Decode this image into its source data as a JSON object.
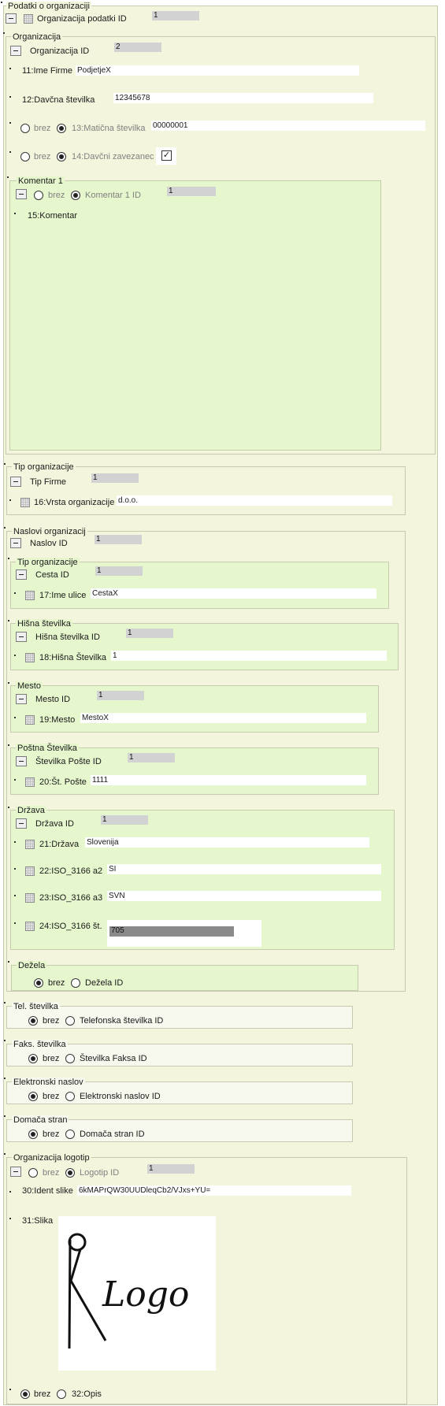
{
  "root": {
    "legend": "Podatki o organizaciji",
    "id_label": "Organizacija podatki ID",
    "id_value": "1"
  },
  "organizacija": {
    "legend": "Organizacija",
    "id_label": "Organizacija ID",
    "id_value": "2",
    "ime_label": "11:Ime Firme",
    "ime_value": "PodjetjeX",
    "davcna_label": "12:Davčna številka",
    "davcna_value": "12345678",
    "brez": "brez",
    "maticna_label": "13:Matična številka",
    "maticna_value": "00000001",
    "zavezanec_label": "14:Davčni zavezanec",
    "zavezanec_checked": true,
    "komentar": {
      "legend": "Komentar 1",
      "id_label": "Komentar 1 ID",
      "id_value": "1",
      "field_label": "15:Komentar"
    }
  },
  "tip_organizacije": {
    "legend": "Tip organizacije",
    "id_label": "Tip Firme",
    "id_value": "1",
    "vrsta_label": "16:Vrsta organizacije",
    "vrsta_value": "d.o.o."
  },
  "naslovi": {
    "legend": "Naslovi organizacij",
    "id_label": "Naslov ID",
    "id_value": "1",
    "cesta": {
      "legend": "Tip organizacije",
      "id_label": "Cesta ID",
      "id_value": "1",
      "field_label": "17:Ime ulice",
      "field_value": "CestaX"
    },
    "hisna": {
      "legend": "Hišna številka",
      "id_label": "Hišna številka ID",
      "id_value": "1",
      "field_label": "18:Hišna Številka",
      "field_value": "1"
    },
    "mesto": {
      "legend": "Mesto",
      "id_label": "Mesto ID",
      "id_value": "1",
      "field_label": "19:Mesto",
      "field_value": "MestoX"
    },
    "posta": {
      "legend": "Poštna Številka",
      "id_label": "Številka Pošte ID",
      "id_value": "1",
      "field_label": "20:Št. Pošte",
      "field_value": "1111"
    },
    "drzava": {
      "legend": "Država",
      "id_label": "Država ID",
      "id_value": "1",
      "drzava_label": "21:Država",
      "drzava_value": "Slovenija",
      "a2_label": "22:ISO_3166 a2",
      "a2_value": "SI",
      "a3_label": "23:ISO_3166 a3",
      "a3_value": "SVN",
      "st_label": "24:ISO_3166 št.",
      "st_value": "705"
    },
    "dezela": {
      "legend": "Dežela",
      "brez": "brez",
      "option": "Dežela ID"
    }
  },
  "tel": {
    "legend": "Tel. številka",
    "brez": "brez",
    "option": "Telefonska številka ID"
  },
  "faks": {
    "legend": "Faks. številka",
    "brez": "brez",
    "option": "Številka Faksa ID"
  },
  "email": {
    "legend": "Elektronski naslov",
    "brez": "brez",
    "option": "Elektronski naslov ID"
  },
  "domaca": {
    "legend": "Domača stran",
    "brez": "brez",
    "option": "Domača stran ID"
  },
  "logotip": {
    "legend": "Organizacija logotip",
    "brez": "brez",
    "id_label": "Logotip ID",
    "id_value": "1",
    "ident_label": "30:Ident slike",
    "ident_value": "6kMAPrQW30UUDleqCb2/VJxs+YU=",
    "slika_label": "31:Slika",
    "logo_text": "Logo",
    "opis_brez": "brez",
    "opis_label": "32:Opis"
  }
}
